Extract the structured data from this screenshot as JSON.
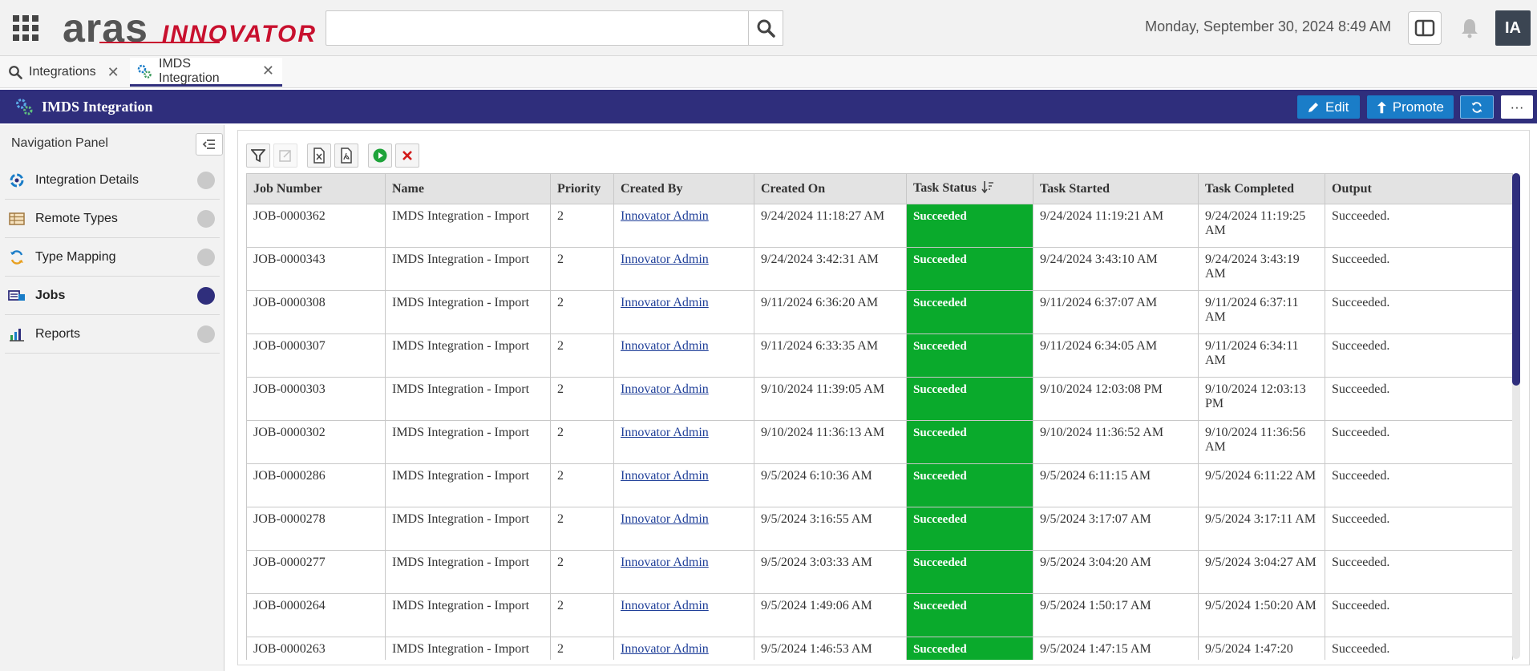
{
  "topbar": {
    "logo_word": "aras",
    "logo_sub": "INNOVATOR",
    "search": {
      "value": "",
      "placeholder": ""
    },
    "datetime": "Monday, September 30, 2024 8:49 AM",
    "avatar_initials": "IA"
  },
  "tabs": [
    {
      "label": "Integrations",
      "icon": "search-icon"
    },
    {
      "label": "IMDS Integration",
      "icon": "gears-icon",
      "active": true
    }
  ],
  "item_header": {
    "title": "IMDS Integration",
    "edit_label": "Edit",
    "promote_label": "Promote",
    "more_label": "···"
  },
  "nav": {
    "title": "Navigation Panel",
    "items": [
      {
        "label": "Integration Details",
        "icon": "integration-icon"
      },
      {
        "label": "Remote Types",
        "icon": "table-icon"
      },
      {
        "label": "Type Mapping",
        "icon": "mapping-icon"
      },
      {
        "label": "Jobs",
        "icon": "jobs-icon",
        "active": true
      },
      {
        "label": "Reports",
        "icon": "bar-chart-icon"
      }
    ]
  },
  "grid": {
    "columns": [
      "Job Number",
      "Name",
      "Priority",
      "Created By",
      "Created On",
      "Task Status",
      "Task Started",
      "Task Completed",
      "Output"
    ],
    "rows": [
      [
        "JOB-0000362",
        "IMDS Integration - Import",
        "2",
        "Innovator Admin",
        "9/24/2024 11:18:27 AM",
        "Succeeded",
        "9/24/2024 11:19:21 AM",
        "9/24/2024 11:19:25 AM",
        "Succeeded."
      ],
      [
        "JOB-0000343",
        "IMDS Integration - Import",
        "2",
        "Innovator Admin",
        "9/24/2024 3:42:31 AM",
        "Succeeded",
        "9/24/2024 3:43:10 AM",
        "9/24/2024 3:43:19 AM",
        "Succeeded."
      ],
      [
        "JOB-0000308",
        "IMDS Integration - Import",
        "2",
        "Innovator Admin",
        "9/11/2024 6:36:20 AM",
        "Succeeded",
        "9/11/2024 6:37:07 AM",
        "9/11/2024 6:37:11 AM",
        "Succeeded."
      ],
      [
        "JOB-0000307",
        "IMDS Integration - Import",
        "2",
        "Innovator Admin",
        "9/11/2024 6:33:35 AM",
        "Succeeded",
        "9/11/2024 6:34:05 AM",
        "9/11/2024 6:34:11 AM",
        "Succeeded."
      ],
      [
        "JOB-0000303",
        "IMDS Integration - Import",
        "2",
        "Innovator Admin",
        "9/10/2024 11:39:05 AM",
        "Succeeded",
        "9/10/2024 12:03:08 PM",
        "9/10/2024 12:03:13 PM",
        "Succeeded."
      ],
      [
        "JOB-0000302",
        "IMDS Integration - Import",
        "2",
        "Innovator Admin",
        "9/10/2024 11:36:13 AM",
        "Succeeded",
        "9/10/2024 11:36:52 AM",
        "9/10/2024 11:36:56 AM",
        "Succeeded."
      ],
      [
        "JOB-0000286",
        "IMDS Integration - Import",
        "2",
        "Innovator Admin",
        "9/5/2024 6:10:36 AM",
        "Succeeded",
        "9/5/2024 6:11:15 AM",
        "9/5/2024 6:11:22 AM",
        "Succeeded."
      ],
      [
        "JOB-0000278",
        "IMDS Integration - Import",
        "2",
        "Innovator Admin",
        "9/5/2024 3:16:55 AM",
        "Succeeded",
        "9/5/2024 3:17:07 AM",
        "9/5/2024 3:17:11 AM",
        "Succeeded."
      ],
      [
        "JOB-0000277",
        "IMDS Integration - Import",
        "2",
        "Innovator Admin",
        "9/5/2024 3:03:33 AM",
        "Succeeded",
        "9/5/2024 3:04:20 AM",
        "9/5/2024 3:04:27 AM",
        "Succeeded."
      ],
      [
        "JOB-0000264",
        "IMDS Integration - Import",
        "2",
        "Innovator Admin",
        "9/5/2024 1:49:06 AM",
        "Succeeded",
        "9/5/2024 1:50:17 AM",
        "9/5/2024 1:50:20 AM",
        "Succeeded."
      ],
      [
        "JOB-0000263",
        "IMDS Integration - Import",
        "2",
        "Innovator Admin",
        "9/5/2024 1:46:53 AM",
        "Succeeded",
        "9/5/2024 1:47:15 AM",
        "9/5/2024 1:47:20",
        "Succeeded."
      ]
    ],
    "sorted_column": "Task Status"
  },
  "colors": {
    "header_bar": "#2f2e7c",
    "button_blue": "#1a7dc8",
    "status_green": "#0aaa2c",
    "brand_red": "#c8102e"
  }
}
